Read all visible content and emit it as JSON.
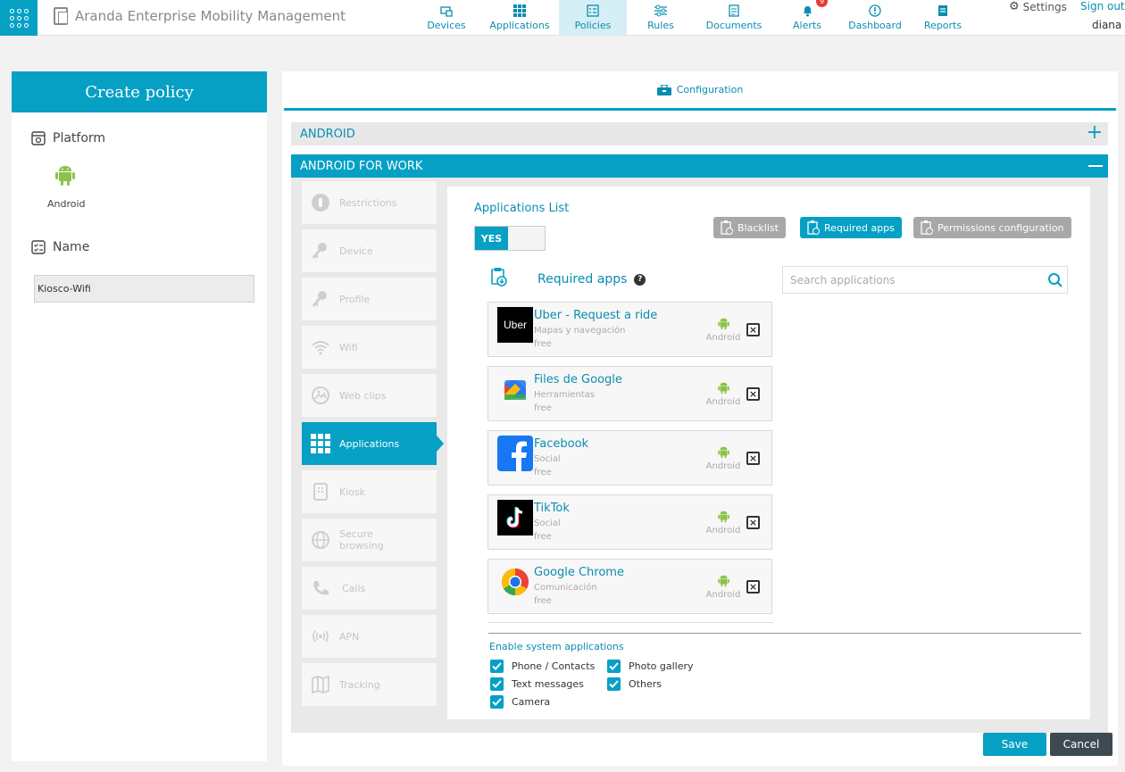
{
  "header": {
    "app_title": "Aranda Enterprise Mobility Management",
    "settings_label": "Settings",
    "signout_label": "Sign out",
    "username": "diana",
    "alerts_badge": "9",
    "nav": [
      {
        "label": "Devices",
        "icon": "devices-icon"
      },
      {
        "label": "Applications",
        "icon": "applications-grid-icon"
      },
      {
        "label": "Policies",
        "icon": "policies-icon",
        "active": true
      },
      {
        "label": "Rules",
        "icon": "rules-icon"
      },
      {
        "label": "Documents",
        "icon": "documents-icon"
      },
      {
        "label": "Alerts",
        "icon": "bell-icon"
      },
      {
        "label": "Dashboard",
        "icon": "dashboard-icon"
      },
      {
        "label": "Reports",
        "icon": "reports-icon"
      }
    ]
  },
  "left_panel": {
    "title": "Create policy",
    "platform_label": "Platform",
    "platform_name": "Android",
    "name_label": "Name",
    "name_value": "Kiosco-Wifi"
  },
  "config": {
    "tab_label": "Configuration",
    "android_section": "ANDROID",
    "afw_section": "ANDROID FOR WORK",
    "side_tabs": [
      {
        "label": "Restrictions",
        "icon": "lock-icon"
      },
      {
        "label": "Device",
        "icon": "device-key-icon"
      },
      {
        "label": "Profile",
        "icon": "profile-key-icon"
      },
      {
        "label": "Wifi",
        "icon": "wifi-icon"
      },
      {
        "label": "Web clips",
        "icon": "web-clips-icon"
      },
      {
        "label": "Applications",
        "icon": "applications-grid-icon",
        "active": true
      },
      {
        "label": "Kiosk",
        "icon": "kiosk-icon"
      },
      {
        "label": "Secure browsing",
        "icon": "globe-icon"
      },
      {
        "label": "Calls",
        "icon": "phone-icon"
      },
      {
        "label": "APN",
        "icon": "apn-icon"
      },
      {
        "label": "Tracking",
        "icon": "map-icon"
      }
    ]
  },
  "applications": {
    "list_title": "Applications List",
    "toggle_label": "YES",
    "toggle_on": true,
    "buttons": {
      "blacklist": "Blacklist",
      "required": "Required apps",
      "permissions": "Permissions configuration"
    },
    "required_title": "Required apps",
    "search_placeholder": "Search applications",
    "apps": [
      {
        "name": "Uber - Request a ride",
        "category": "Mapas y navegación",
        "price": "free",
        "platform": "Android",
        "logo": "Uber"
      },
      {
        "name": "Files de Google",
        "category": "Herramientas",
        "price": "free",
        "platform": "Android",
        "logo": "files-google-logo"
      },
      {
        "name": "Facebook",
        "category": "Social",
        "price": "free",
        "platform": "Android",
        "logo": "facebook-logo"
      },
      {
        "name": "TikTok",
        "category": "Social",
        "price": "free",
        "platform": "Android",
        "logo": "tiktok-logo"
      },
      {
        "name": "Google Chrome",
        "category": "Comunicación",
        "price": "free",
        "platform": "Android",
        "logo": "chrome-logo"
      }
    ],
    "system_apps_title": "Enable system applications",
    "system_apps": [
      {
        "label": "Phone / Contacts",
        "checked": true
      },
      {
        "label": "Photo gallery",
        "checked": true
      },
      {
        "label": "Text messages",
        "checked": true
      },
      {
        "label": "Others",
        "checked": true
      },
      {
        "label": "Camera",
        "checked": true
      }
    ]
  },
  "footer": {
    "save_label": "Save",
    "cancel_label": "Cancel"
  },
  "colors": {
    "accent": "#06a0c5",
    "android_green": "#8bc34a",
    "cancel_dark": "#3d4a52"
  }
}
